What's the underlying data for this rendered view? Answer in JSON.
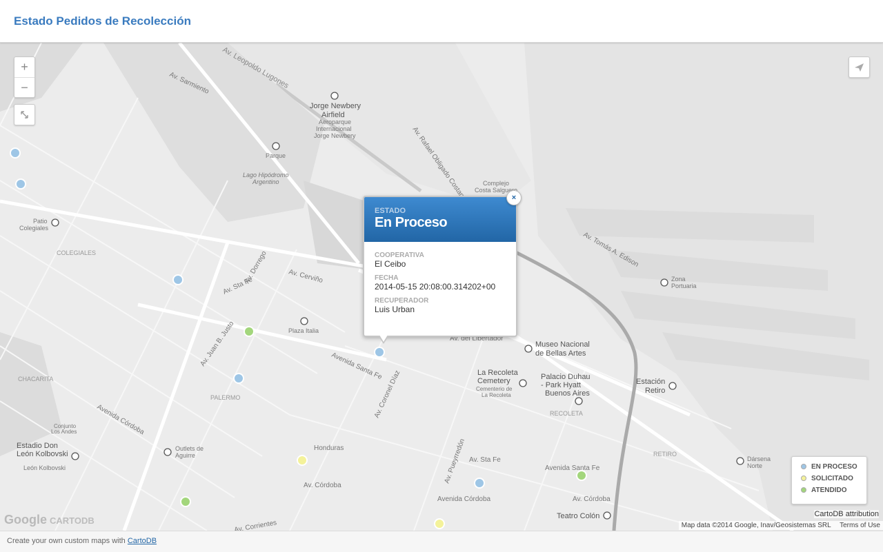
{
  "header": {
    "title": "Estado Pedidos de Recolección"
  },
  "controls": {
    "zoom_in": "+",
    "zoom_out": "−"
  },
  "popup": {
    "estado_label": "ESTADO",
    "estado_value": "En Proceso",
    "cooperativa_label": "COOPERATIVA",
    "cooperativa_value": "El Ceibo",
    "fecha_label": "FECHA",
    "fecha_value": "2014-05-15 20:08:00.314202+00",
    "recuperador_label": "RECUPERADOR",
    "recuperador_value": "Luis Urban",
    "close_label": "×"
  },
  "legend": {
    "items": [
      {
        "label": "EN PROCESO",
        "color": "#9ec6e6"
      },
      {
        "label": "SOLICITADO",
        "color": "#f4f29a"
      },
      {
        "label": "ATENDIDO",
        "color": "#a3d67c"
      }
    ]
  },
  "attribution": {
    "cartodb": "CartoDB attribution",
    "map_data": "Map data ©2014 Google, Inav/Geosistemas SRL",
    "terms": "Terms of Use",
    "google": "Google",
    "cartodb_logo": "CARTODB"
  },
  "footer": {
    "text": "Create your own custom maps with",
    "link": "CartoDB"
  },
  "map_labels": [
    "Jorge Newbery Airfield",
    "Aeroparque Internacional Jorge Newbery",
    "Parque",
    "Lago Hipódromo Argentino",
    "Av. Leopoldo Lugones",
    "Av. Rafael Obligado Costanera",
    "Complejo Costa Salguero",
    "Patio Colegiales",
    "COLEGIALES",
    "Plaza Italia",
    "PALERMO",
    "CHACARITA",
    "Museo Nacional de Bellas Artes",
    "La Recoleta Cemetery",
    "Palacio Duhau - Park Hyatt Buenos Aires",
    "RECOLETA",
    "Estación Retiro",
    "RETIRO",
    "Zona Portuaria",
    "Dársena Norte",
    "Teatro Colón",
    "Outlets de Aguirre",
    "Estadio Don León Kolbovski",
    "Conjunto Los Andes",
    "Av. Libertador",
    "Av. Santa Fe",
    "Avenida Córdoba",
    "Av. Corrientes",
    "Av. Pueyrredón",
    "Av. Tomás A. Edison",
    "Av. Dorrego",
    "Av. Cerviño",
    "Av. Juan B. Justo",
    "Av. Sarmiento",
    "Avenida Santa Fe",
    "Av. Coronel Díaz"
  ],
  "markers": [
    {
      "status": "en_proceso"
    },
    {
      "status": "en_proceso"
    },
    {
      "status": "en_proceso"
    },
    {
      "status": "en_proceso"
    },
    {
      "status": "en_proceso"
    },
    {
      "status": "en_proceso"
    },
    {
      "status": "atendido"
    },
    {
      "status": "atendido"
    },
    {
      "status": "atendido"
    },
    {
      "status": "solicitado"
    },
    {
      "status": "solicitado"
    }
  ]
}
